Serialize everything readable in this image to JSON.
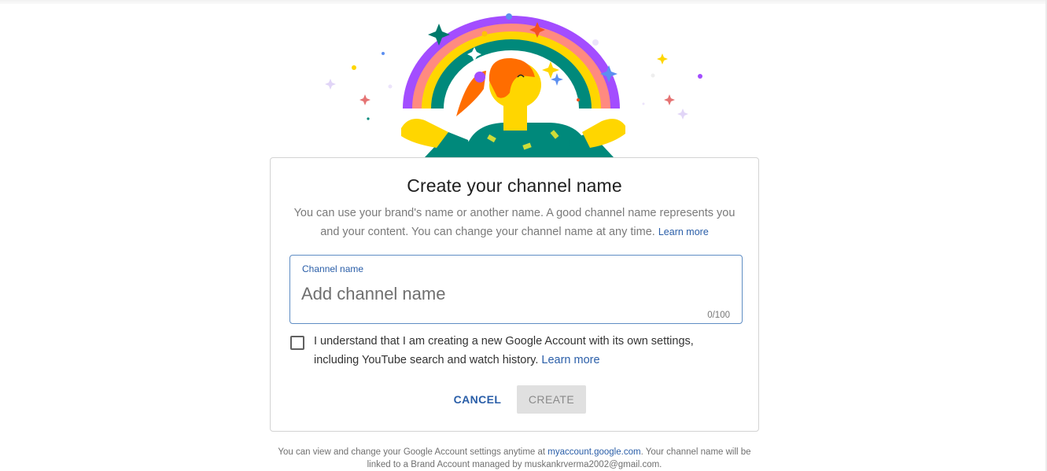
{
  "dialog": {
    "title": "Create your channel name",
    "description": "You can use your brand's name or another name. A good channel name represents you and your content. You can change your channel name at any time.",
    "description_link": "Learn more",
    "field": {
      "label": "Channel name",
      "value": "",
      "placeholder": "Add channel name",
      "counter": "0/100"
    },
    "checkbox": {
      "checked": false,
      "text": "I understand that I am creating a new Google Account with its own settings, including YouTube search and watch history.",
      "link": "Learn more"
    },
    "buttons": {
      "cancel": "CANCEL",
      "create": "CREATE"
    }
  },
  "footer": {
    "text_before": "You can view and change your Google Account settings anytime at ",
    "link": "myaccount.google.com",
    "text_after": ". Your channel name will be linked to a Brand Account managed by muskankrverma2002@gmail.com."
  },
  "colors": {
    "accent": "#2a5ea8",
    "rainbow": [
      "#a34dff",
      "#ff8a80",
      "#ffd600",
      "#00897b"
    ],
    "hair": "#ff6d00",
    "skin": "#ffd600",
    "shirt": "#00897b"
  },
  "illustration": {
    "icon": "rainbow-person-illustration"
  }
}
